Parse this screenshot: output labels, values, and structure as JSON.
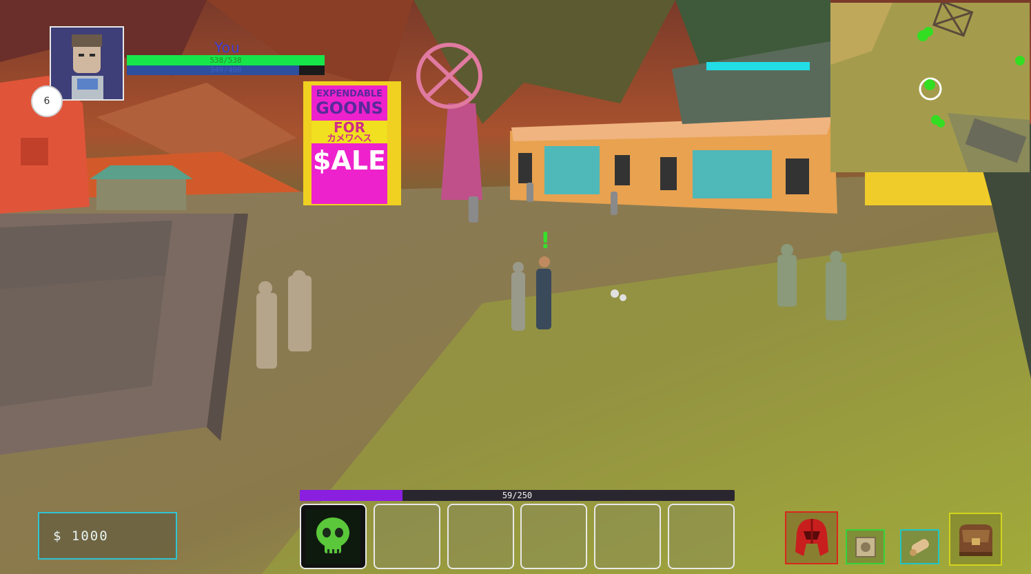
{
  "player": {
    "name": "You",
    "level": "6",
    "hp_text": "538/538",
    "hp_fraction": 1.0,
    "mp_text": "349/400",
    "mp_fraction": 0.8725,
    "portrait_icon": "armored-pilot-portrait-icon"
  },
  "billboard": {
    "line1": "EXPENDABLE",
    "line2": "GOONS",
    "line3": "FOR",
    "line4": "カメワヘス",
    "line5": "$ALE"
  },
  "quest_marker": "!",
  "experience": {
    "text": "59/250",
    "fraction": 0.236
  },
  "hotbar": {
    "slots": [
      {
        "icon": "green-skull-icon",
        "filled": true
      },
      {
        "icon": "",
        "filled": false
      },
      {
        "icon": "",
        "filled": false
      },
      {
        "icon": "",
        "filled": false
      },
      {
        "icon": "",
        "filled": false
      },
      {
        "icon": "",
        "filled": false
      }
    ]
  },
  "wallet": {
    "text": "$ 1000"
  },
  "menu": {
    "buttons": [
      {
        "name": "equipment-button",
        "icon": "red-helmet-icon",
        "border": "#d9261c"
      },
      {
        "name": "skills-button",
        "icon": "skill-book-icon",
        "border": "#34d43c"
      },
      {
        "name": "quests-button",
        "icon": "scroll-icon",
        "border": "#1fc6c6"
      },
      {
        "name": "inventory-button",
        "icon": "backpack-icon",
        "border": "#d4d41c"
      }
    ]
  },
  "colors": {
    "hp": "#16e64a",
    "mp": "#2d4f9e",
    "xp": "#8a1fe0",
    "wallet_border": "#2fc4d4",
    "minimap_player_marker": "#ffffff",
    "minimap_npc_marker": "#33dd22"
  }
}
